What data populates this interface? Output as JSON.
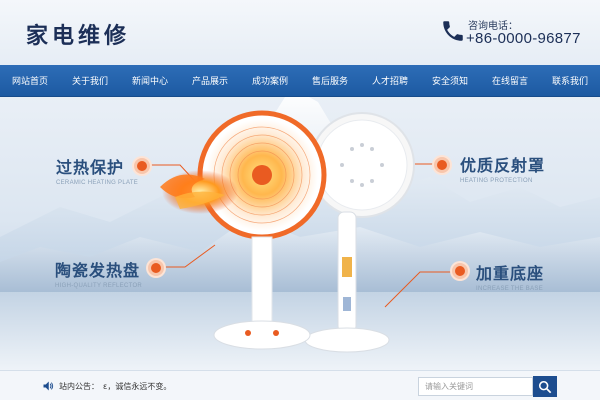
{
  "header": {
    "logo": "家电维修",
    "hotline_label": "咨询电话：",
    "hotline_number": "+86-0000-96877"
  },
  "nav": {
    "items": [
      {
        "label": "网站首页"
      },
      {
        "label": "关于我们"
      },
      {
        "label": "新闻中心"
      },
      {
        "label": "产品展示"
      },
      {
        "label": "成功案例"
      },
      {
        "label": "售后服务"
      },
      {
        "label": "人才招聘"
      },
      {
        "label": "安全须知"
      },
      {
        "label": "在线留言"
      },
      {
        "label": "联系我们"
      }
    ]
  },
  "banner": {
    "features": [
      {
        "title": "过热保护",
        "subtitle": "CERAMIC HEATING PLATE"
      },
      {
        "title": "陶瓷发热盘",
        "subtitle": "HIGH-QUALITY REFLECTOR"
      },
      {
        "title": "优质反射罩",
        "subtitle": "HEATING PROTECTION"
      },
      {
        "title": "加重底座",
        "subtitle": "INCREASE THE BASE"
      }
    ],
    "colors": {
      "accent": "#e95b21",
      "title": "#2a4f7d",
      "nav": "#1d5aa2"
    }
  },
  "notice": {
    "label": "站内公告：",
    "text": "ε，诚信永远不变。"
  },
  "search": {
    "placeholder": "请输入关键词"
  },
  "icons": [
    "phone-icon",
    "speaker-icon",
    "search-icon"
  ]
}
